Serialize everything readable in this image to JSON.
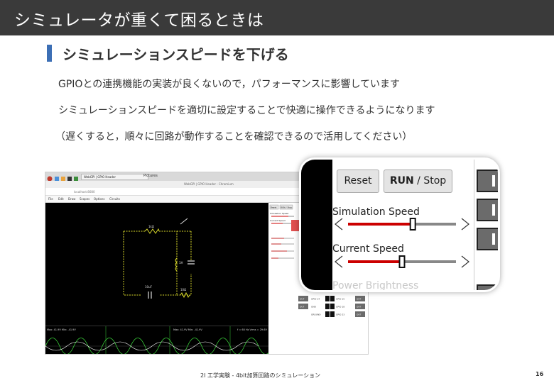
{
  "slide": {
    "title": "シミュレータが重くて困るときは",
    "heading": "シミュレーションスピードを下げる",
    "lines": [
      "GPIOとの連携機能の実装が良くないので，パフォーマンスに影響しています",
      "シミュレーションスピードを適切に設定することで快適に操作できるようになります",
      "（遅くすると，順々に回路が動作することを確認できるので活用してください）"
    ],
    "footer": "2I 工学実験 - 4bit加算回路のシミュレーション",
    "page_number": "16"
  },
  "zoom": {
    "reset_label": "Reset",
    "run_label": "RUN",
    "stop_label": " / Stop",
    "sim_speed_label": "Simulation Speed",
    "sim_speed_value": 0.6,
    "current_speed_label": "Current Speed",
    "current_speed_value": 0.5,
    "power_label": "Power Brightness"
  },
  "screenshot": {
    "tab_title": "WebGPI | GPIO Header",
    "folder_label": "Pictures",
    "window_title": "WebGPI | GPIO Header - Chromium",
    "url": "localhost:8080",
    "menu": [
      "File",
      "Edit",
      "Draw",
      "Scopes",
      "Options",
      "Circuits"
    ],
    "reset_label": "Reset",
    "run_label": "RUN / Stop",
    "sim_label": "Simulation Speed",
    "cur_label": "Current Speed",
    "circuit_labels": [
      "1kΩ",
      "1H",
      "10uF",
      "10Ω"
    ],
    "scope_text_left": "Max: 41.9V  Min: -41.9V",
    "scope_text_mid": "Max: 41.9V  Min: -41.9V",
    "scope_text_right": "f = 60 Hz  Vrms = 29.6V",
    "gpio_labels": [
      "OUT",
      "GPIO 14",
      "GPIO 15",
      "OUT",
      "OUT",
      "GPIO 18",
      "GND",
      "OUT",
      "GROUND",
      "GPIO 23",
      "OUT"
    ]
  },
  "colors": {
    "title_bar": "#3a3a3a",
    "heading_mark": "#3c6fb5",
    "arrow": "#e05050",
    "slider_fill": "#cc0000",
    "slider_track": "#888888",
    "circuit_wire": "#d8d82a"
  }
}
